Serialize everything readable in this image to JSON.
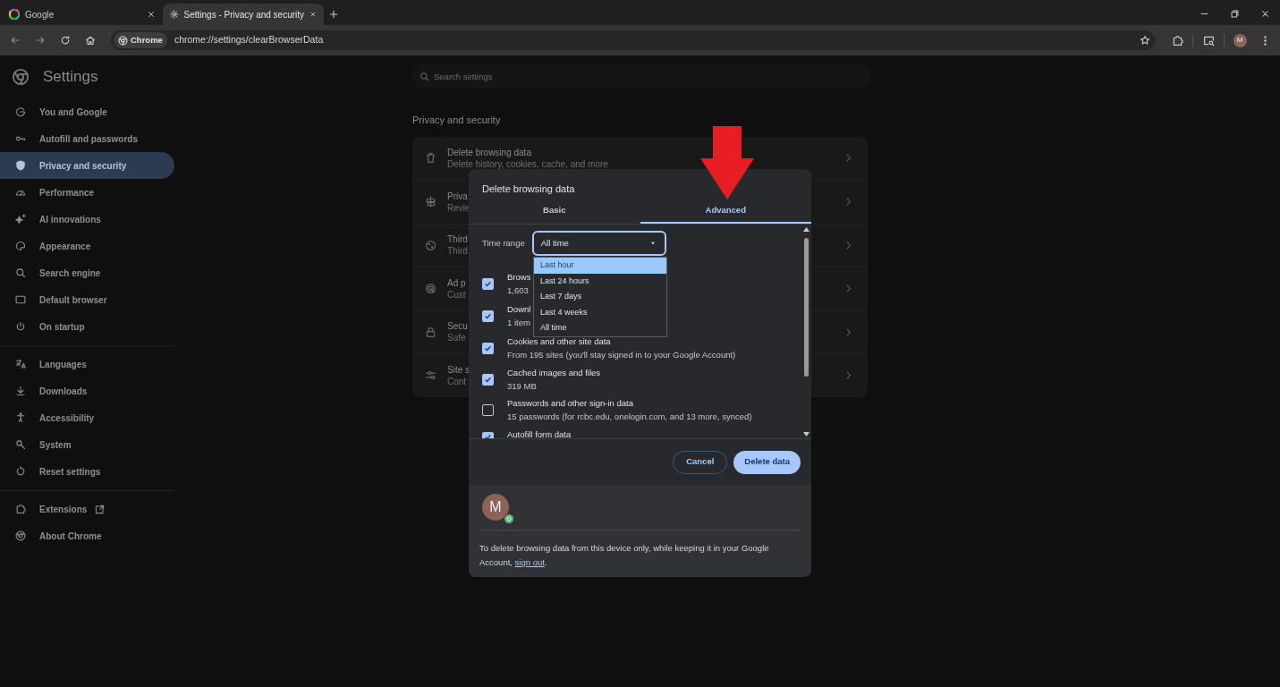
{
  "browser": {
    "tabs": [
      {
        "title": "Google",
        "selected": false
      },
      {
        "title": "Settings - Privacy and security",
        "selected": true
      }
    ],
    "chip": "Chrome",
    "url": "chrome://settings/clearBrowserData",
    "profile": "M"
  },
  "settings": {
    "title": "Settings",
    "search": {
      "placeholder": "Search settings"
    },
    "sidebar": [
      [
        {
          "label": "You and Google",
          "selected": false
        },
        {
          "label": "Autofill and passwords",
          "selected": false
        },
        {
          "label": "Privacy and security",
          "selected": true
        },
        {
          "label": "Performance",
          "selected": false
        },
        {
          "label": "AI innovations",
          "selected": false
        },
        {
          "label": "Appearance",
          "selected": false
        },
        {
          "label": "Search engine",
          "selected": false
        },
        {
          "label": "Default browser",
          "selected": false
        },
        {
          "label": "On startup",
          "selected": false
        }
      ],
      [
        {
          "label": "Languages",
          "selected": false
        },
        {
          "label": "Downloads",
          "selected": false
        },
        {
          "label": "Accessibility",
          "selected": false
        },
        {
          "label": "System",
          "selected": false
        },
        {
          "label": "Reset settings",
          "selected": false
        }
      ],
      [
        {
          "label": "Extensions",
          "selected": false
        },
        {
          "label": "About Chrome",
          "selected": false
        }
      ]
    ],
    "section_title": "Privacy and security",
    "rows": [
      {
        "title": "Delete browsing data",
        "subtitle": "Delete history, cookies, cache, and more"
      },
      {
        "title": "Priva",
        "subtitle": "Revie"
      },
      {
        "title": "Third",
        "subtitle": "Third"
      },
      {
        "title": "Ad p",
        "subtitle": "Cust"
      },
      {
        "title": "Secu",
        "subtitle": "Safe"
      },
      {
        "title": "Site s",
        "subtitle": "Cont"
      }
    ]
  },
  "dialog": {
    "title": "Delete browsing data",
    "tabs": [
      {
        "label": "Basic",
        "selected": false
      },
      {
        "label": "Advanced",
        "selected": true
      }
    ],
    "time_range": {
      "label": "Time range",
      "value": "All time",
      "expanded": true,
      "options": [
        {
          "label": "Last hour",
          "highlighted": true
        },
        {
          "label": "Last 24 hours",
          "highlighted": false
        },
        {
          "label": "Last 7 days",
          "highlighted": false
        },
        {
          "label": "Last 4 weeks",
          "highlighted": false
        },
        {
          "label": "All time",
          "highlighted": false
        }
      ]
    },
    "items": [
      {
        "title": "Brows",
        "detail": "1,603",
        "checked": true
      },
      {
        "title": "Downl",
        "detail": "1 item",
        "checked": true
      },
      {
        "title": "Cookies and other site data",
        "detail": "From 195 sites (you'll stay signed in to your Google Account)",
        "checked": true
      },
      {
        "title": "Cached images and files",
        "detail": "319 MB",
        "checked": true
      },
      {
        "title": "Passwords and other sign-in data",
        "detail": "15 passwords (for rcbc.edu, onelogin.com, and 13 more, synced)",
        "checked": false
      },
      {
        "title": "Autofill form data",
        "checked": true
      }
    ],
    "buttons": {
      "cancel": "Cancel",
      "confirm": "Delete data"
    },
    "account": {
      "initial": "M",
      "note": "To delete browsing data from this device only, while keeping it in your Google Account, ",
      "link": "sign out",
      "note_end": "."
    }
  }
}
